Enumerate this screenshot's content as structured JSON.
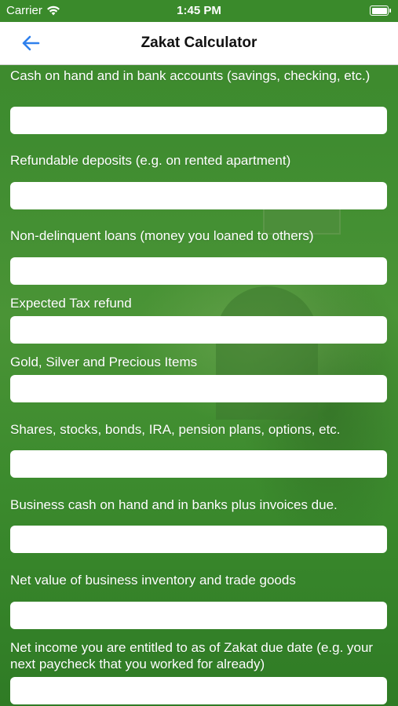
{
  "status_bar": {
    "carrier": "Carrier",
    "time": "1:45 PM"
  },
  "header": {
    "title": "Zakat Calculator"
  },
  "fields": [
    {
      "label": "Cash on hand and in bank accounts (savings, checking, etc.)",
      "value": ""
    },
    {
      "label": "Refundable deposits (e.g. on rented apartment)",
      "value": ""
    },
    {
      "label": "Non-delinquent loans (money you loaned to others)",
      "value": ""
    },
    {
      "label": "Expected Tax refund",
      "value": ""
    },
    {
      "label": "Gold, Silver and Precious Items",
      "value": ""
    },
    {
      "label": "Shares, stocks, bonds, IRA, pension plans, options, etc.",
      "value": ""
    },
    {
      "label": "Business cash on hand and in banks plus invoices due.",
      "value": ""
    },
    {
      "label": "Net value of business inventory and trade goods",
      "value": ""
    },
    {
      "label": "Net income you are entitled to as of Zakat due date (e.g. your next paycheck that you worked for already)",
      "value": ""
    }
  ],
  "colors": {
    "accent": "#2f80ed",
    "background": "#3f8a2e"
  },
  "icons": {
    "back": "back-arrow-icon",
    "wifi": "wifi-icon",
    "battery": "battery-icon"
  }
}
